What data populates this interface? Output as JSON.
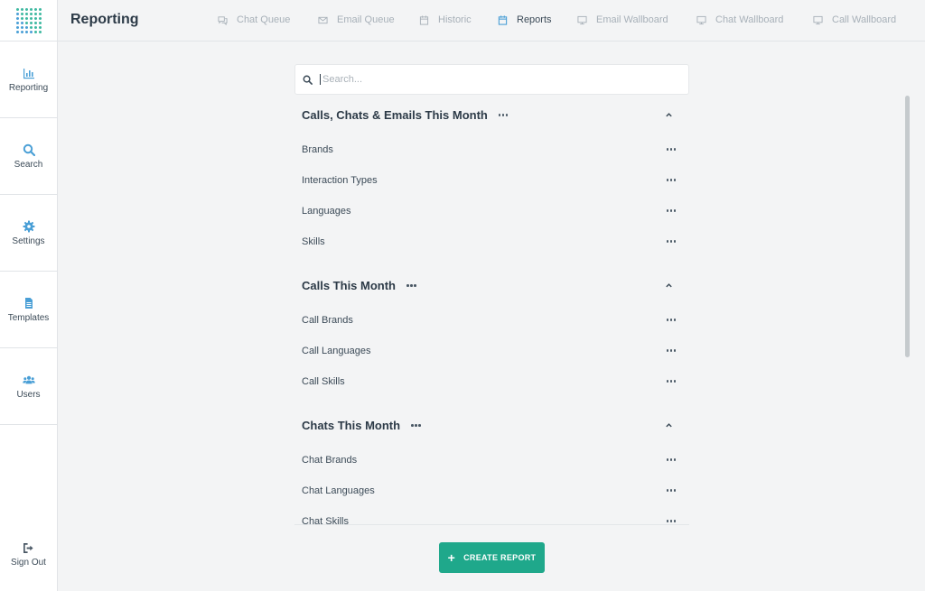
{
  "app": {
    "title": "Reporting",
    "accent_color": "#1fa88b",
    "link_color": "#4a9fd6"
  },
  "sidebar": {
    "items": [
      {
        "label": "Reporting",
        "icon": "bar-chart-icon"
      },
      {
        "label": "Search",
        "icon": "search-icon"
      },
      {
        "label": "Settings",
        "icon": "gear-icon"
      },
      {
        "label": "Templates",
        "icon": "document-icon"
      },
      {
        "label": "Users",
        "icon": "users-icon"
      }
    ],
    "signout": {
      "label": "Sign Out",
      "icon": "sign-out-icon"
    }
  },
  "tabs": [
    {
      "label": "Chat Queue",
      "icon": "chat-icon",
      "active": false
    },
    {
      "label": "Email Queue",
      "icon": "envelope-icon",
      "active": false
    },
    {
      "label": "Historic",
      "icon": "calendar-icon",
      "active": false
    },
    {
      "label": "Reports",
      "icon": "calendar-icon",
      "active": true
    },
    {
      "label": "Email Wallboard",
      "icon": "monitor-icon",
      "active": false
    },
    {
      "label": "Chat Wallboard",
      "icon": "monitor-icon",
      "active": false
    },
    {
      "label": "Call Wallboard",
      "icon": "monitor-icon",
      "active": false
    }
  ],
  "search": {
    "placeholder": "Search...",
    "value": ""
  },
  "sections": [
    {
      "title": "Calls, Chats & Emails This Month",
      "expanded": true,
      "items": [
        "Brands",
        "Interaction Types",
        "Languages",
        "Skills"
      ]
    },
    {
      "title": "Calls This Month",
      "expanded": true,
      "items": [
        "Call Brands",
        "Call Languages",
        "Call Skills"
      ]
    },
    {
      "title": "Chats This Month",
      "expanded": true,
      "items": [
        "Chat Brands",
        "Chat Languages",
        "Chat Skills"
      ]
    }
  ],
  "create_button": {
    "label": "CREATE REPORT"
  }
}
